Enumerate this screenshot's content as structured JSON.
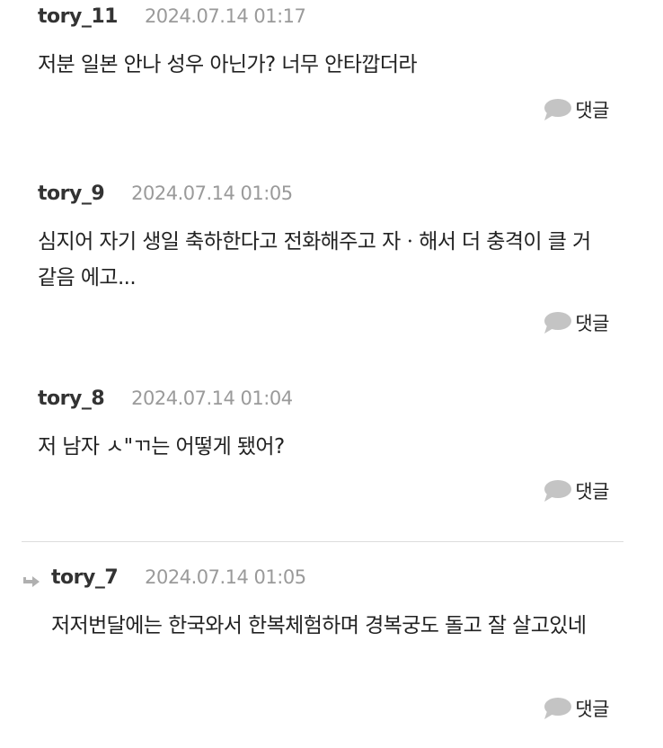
{
  "comments": [
    {
      "author": "tory_11",
      "date": "2024.07.14 01:17",
      "text": "저분 일본 안나 성우 아닌가?  너무 안타깝더라",
      "reply_label": "댓글"
    },
    {
      "author": "tory_9",
      "date": "2024.07.14 01:05",
      "text": "심지어 자기 생일 축하한다고 전화해주고 자ㆍ해서 더 충격이 클 거 같음 에고...",
      "reply_label": "댓글"
    },
    {
      "author": "tory_8",
      "date": "2024.07.14 01:04",
      "text": "저 남자 ㅅ\"ㄲ는 어떻게 됐어?",
      "reply_label": "댓글"
    },
    {
      "author": "tory_7",
      "date": "2024.07.14 01:05",
      "text": "저저번달에는 한국와서 한복체험하며 경복궁도 돌고 잘 살고있네",
      "reply_label": "댓글",
      "is_reply": true
    }
  ],
  "icons": {
    "reply_bubble": "speech-bubble-icon",
    "reply_arrow": "reply-arrow-icon"
  },
  "colors": {
    "author": "#333333",
    "date": "#9a9a9a",
    "text": "#222222",
    "bubble": "#c4c4c4",
    "divider": "#dddddd",
    "reply_arrow": "#b0b0b0"
  }
}
